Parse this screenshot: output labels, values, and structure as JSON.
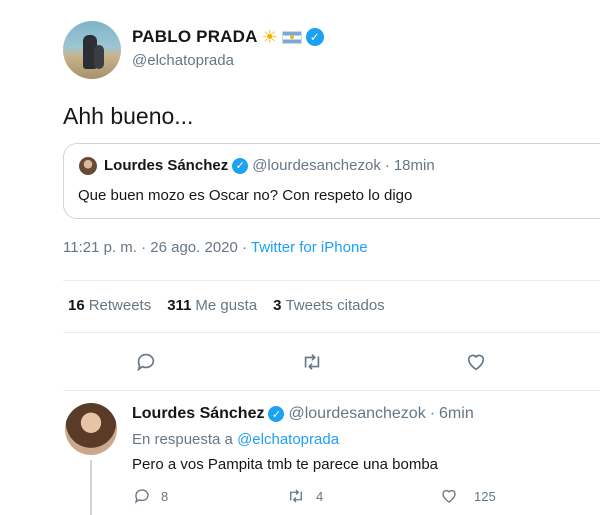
{
  "tweet": {
    "author_name": "PABLO PRADA",
    "author_emoji_icons": [
      "sun-emoji",
      "argentina-flag-emoji"
    ],
    "author_handle": "@elchatoprada",
    "text": "Ahh bueno...",
    "quoted": {
      "author_name": "Lourdes Sánchez",
      "author_handle": "@lourdesanchezok",
      "separator": "·",
      "time": "18min",
      "text": "Que buen mozo es Oscar no? Con respeto lo digo"
    },
    "timestamp": "11:21 p. m. · 26 ago. 2020 ·",
    "client": "Twitter for iPhone",
    "stats": {
      "retweets_count": "16",
      "retweets_label": "Retweets",
      "likes_count": "311",
      "likes_label": "Me gusta",
      "quotes_count": "3",
      "quotes_label": "Tweets citados"
    }
  },
  "reply": {
    "author_name": "Lourdes Sánchez",
    "author_handle": "@lourdesanchezok",
    "separator": "·",
    "time": "6min",
    "in_reply_prefix": "En respuesta a",
    "in_reply_handle": "@elchatoprada",
    "text": "Pero a vos Pampita tmb te parece una bomba",
    "reply_count": "8",
    "retweet_count": "4",
    "like_count": "125"
  },
  "colors": {
    "accent": "#1da1f2",
    "text": "#14171a",
    "muted": "#657786",
    "border": "#e6ecf0"
  }
}
